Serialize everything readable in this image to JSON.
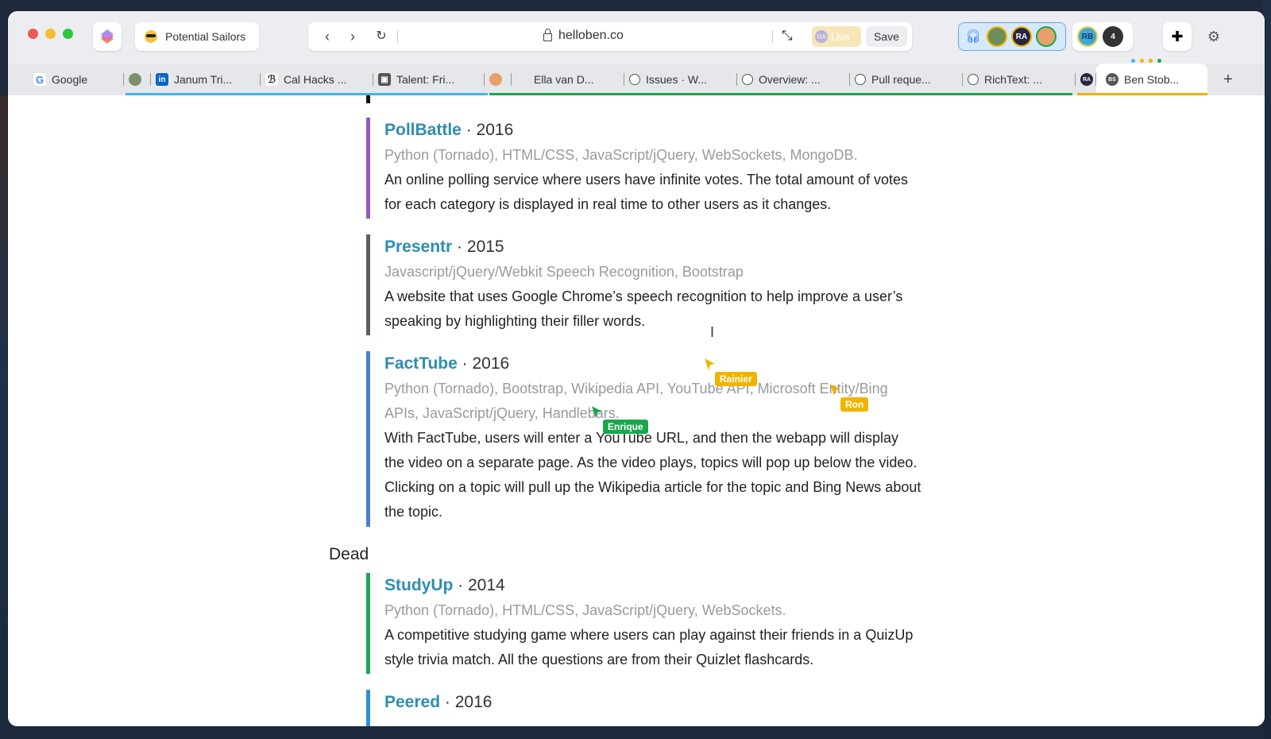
{
  "window": {
    "space_name": "Potential Sailors",
    "url": "helloben.co",
    "live_label": "Live",
    "live_avatar": "RA",
    "save_label": "Save",
    "collab_avatars": [
      "RA"
    ],
    "people_avatar": "RB",
    "people_count": "4"
  },
  "tabs": [
    {
      "label": "Google"
    },
    {
      "label": ""
    },
    {
      "label": "Janum Tri..."
    },
    {
      "label": "Cal Hacks ..."
    },
    {
      "label": "Talent: Fri..."
    },
    {
      "label": ""
    },
    {
      "label": "Ella van D..."
    },
    {
      "label": "Issues · W..."
    },
    {
      "label": "Overview: ..."
    },
    {
      "label": "Pull reque..."
    },
    {
      "label": "RichText: ..."
    },
    {
      "label": "RA"
    },
    {
      "label": "Ben Stob..."
    }
  ],
  "projects": [
    {
      "name": "PollBattle",
      "sep": " · ",
      "year": "2016",
      "tech": "Python (Tornado), HTML/CSS, JavaScript/jQuery, WebSockets, MongoDB.",
      "desc": "An online polling service where users have infinite votes. The total amount of votes for each category is displayed in real time to other users as it changes.",
      "color": "#9b59b6"
    },
    {
      "name": "Presentr",
      "sep": " · ",
      "year": "2015",
      "tech": "Javascript/jQuery/Webkit Speech Recognition, Bootstrap",
      "desc": "A website that uses Google Chrome’s speech recognition to help improve a user’s speaking by highlighting their filler words.",
      "color": "#5a5f6a"
    },
    {
      "name": "FactTube",
      "sep": " · ",
      "year": "2016",
      "tech": "Python (Tornado), Bootstrap, Wikipedia API, YouTube API, Microsoft Entity/Bing APIs, JavaScript/jQuery, Handlebars.",
      "desc": "With FactTube, users will enter a YouTube URL, and then the webapp will display the video on a separate page. As the video plays, topics will pop up below the video. Clicking on a topic will pull up the Wikipedia article for the topic and Bing News about the topic.",
      "color": "#4a7fd4"
    },
    {
      "name": "StudyUp",
      "sep": " · ",
      "year": "2014",
      "tech": "Python (Tornado), HTML/CSS, JavaScript/jQuery, WebSockets.",
      "desc": "A competitive studying game where users can play against their friends in a QuizUp style trivia match. All the questions are from their Quizlet flashcards.",
      "color": "#1fa55c"
    },
    {
      "name": "Peered",
      "sep": " · ",
      "year": "2016",
      "tech": "",
      "desc": "",
      "color": "#2d8de0"
    }
  ],
  "section_dead": "Dead",
  "cursors": [
    {
      "name": "Rainier",
      "color": "#f0b400"
    },
    {
      "name": "Ron",
      "color": "#f0b400"
    },
    {
      "name": "Enrique",
      "color": "#1aa64d"
    }
  ]
}
